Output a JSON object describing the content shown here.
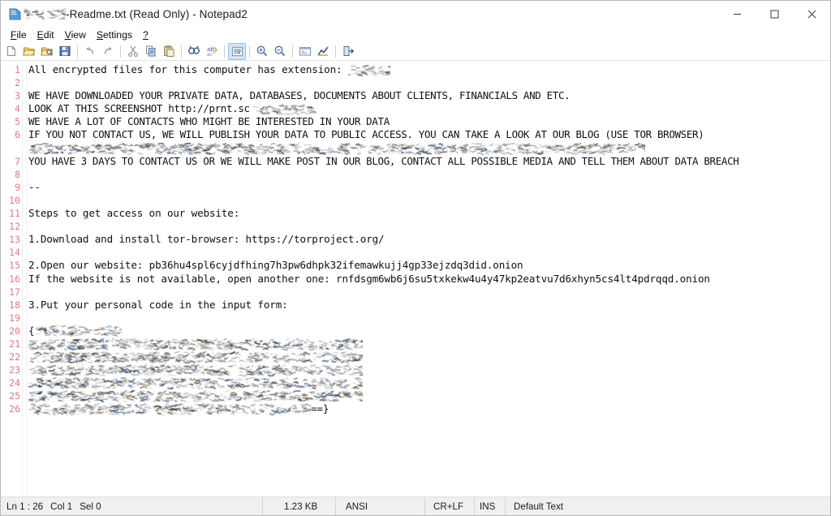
{
  "window": {
    "title_prefix_redacted": true,
    "title": "-Readme.txt (Read Only) - Notepad2",
    "icon": "notepad2-icon",
    "controls": {
      "minimize": "minimize-icon",
      "maximize": "maximize-icon",
      "close": "close-icon"
    }
  },
  "menubar": {
    "items": [
      {
        "label": "File",
        "mnemonic": "F"
      },
      {
        "label": "Edit",
        "mnemonic": "E"
      },
      {
        "label": "View",
        "mnemonic": "V"
      },
      {
        "label": "Settings",
        "mnemonic": "S"
      },
      {
        "label": "?",
        "mnemonic": "?"
      }
    ]
  },
  "toolbar": {
    "buttons": [
      {
        "name": "new-file-icon",
        "title": "New"
      },
      {
        "name": "open-file-icon",
        "title": "Open"
      },
      {
        "name": "browse-file-icon",
        "title": "Browse"
      },
      {
        "name": "save-file-icon",
        "title": "Save"
      },
      {
        "name": "undo-icon",
        "title": "Undo"
      },
      {
        "name": "redo-icon",
        "title": "Redo"
      },
      {
        "name": "cut-icon",
        "title": "Cut"
      },
      {
        "name": "copy-icon",
        "title": "Copy"
      },
      {
        "name": "paste-icon",
        "title": "Paste"
      },
      {
        "name": "find-icon",
        "title": "Find"
      },
      {
        "name": "replace-icon",
        "title": "Replace"
      },
      {
        "name": "word-wrap-icon",
        "title": "Word Wrap",
        "active": true
      },
      {
        "name": "zoom-in-icon",
        "title": "Zoom In"
      },
      {
        "name": "zoom-out-icon",
        "title": "Zoom Out"
      },
      {
        "name": "scheme-icon",
        "title": "Scheme"
      },
      {
        "name": "favorites-icon",
        "title": "Favorites"
      },
      {
        "name": "exit-icon",
        "title": "Exit"
      }
    ]
  },
  "editor": {
    "line_numbers": [
      "1",
      "2",
      "3",
      "4",
      "5",
      "6",
      "",
      "7",
      "8",
      "9",
      "10",
      "11",
      "12",
      "13",
      "14",
      "15",
      "16",
      "17",
      "18",
      "19",
      "20",
      "21",
      "22",
      "23",
      "24",
      "25",
      "26"
    ],
    "lines": [
      {
        "n": "1",
        "text": "All encrypted files for this computer has extension: ",
        "redact_after": 1
      },
      {
        "n": "2",
        "text": ""
      },
      {
        "n": "3",
        "text": "WE HAVE DOWNLOADED YOUR PRIVATE DATA, DATABASES, DOCUMENTS ABOUT CLIENTS, FINANCIALS AND ETC.",
        "caps": true
      },
      {
        "n": "4",
        "text": "LOOK AT THIS SCREENSHOT http://prnt.sc",
        "redact_after": 2,
        "caps": true
      },
      {
        "n": "5",
        "text": "WE HAVE A LOT OF CONTACTS WHO MIGHT BE INTERESTED IN YOUR DATA",
        "caps": true
      },
      {
        "n": "6",
        "text": "IF YOU NOT CONTACT US, WE WILL PUBLISH YOUR DATA TO PUBLIC ACCESS. YOU CAN TAKE A LOOK AT OUR BLOG (USE TOR BROWSER)",
        "caps": true
      },
      {
        "n": "",
        "text": "",
        "redact_full": 3
      },
      {
        "n": "7",
        "text": "YOU HAVE 3 DAYS TO CONTACT US OR WE WILL MAKE POST IN OUR BLOG, CONTACT ALL POSSIBLE MEDIA AND TELL THEM ABOUT DATA BREACH",
        "caps": true
      },
      {
        "n": "8",
        "text": ""
      },
      {
        "n": "9",
        "text": "--"
      },
      {
        "n": "10",
        "text": ""
      },
      {
        "n": "11",
        "text": "Steps to get access on our website:"
      },
      {
        "n": "12",
        "text": ""
      },
      {
        "n": "13",
        "text": "1.Download and install tor-browser: https://torproject.org/"
      },
      {
        "n": "14",
        "text": ""
      },
      {
        "n": "15",
        "text": "2.Open our website: pb36hu4spl6cyjdfhing7h3pw6dhpk32ifemawkujj4gp33ejzdq3did.onion"
      },
      {
        "n": "16",
        "text": "If the website is not available, open another one: rnfdsgm6wb6j6su5txkekw4u4y47kp2eatvu7d6xhyn5cs4lt4pdrqqd.onion"
      },
      {
        "n": "17",
        "text": ""
      },
      {
        "n": "18",
        "text": "3.Put your personal code in the input form:"
      },
      {
        "n": "19",
        "text": ""
      },
      {
        "n": "20",
        "text": "{",
        "redact_after": 4
      },
      {
        "n": "21",
        "text": "",
        "redact_full": 5
      },
      {
        "n": "22",
        "text": "",
        "redact_full": 6
      },
      {
        "n": "23",
        "text": "",
        "redact_full": 7
      },
      {
        "n": "24",
        "text": "",
        "redact_full": 8
      },
      {
        "n": "25",
        "text": "",
        "redact_full": 9
      },
      {
        "n": "26",
        "text": "",
        "redact_full": 10,
        "suffix": "==}"
      }
    ]
  },
  "statusbar": {
    "line_label": "Ln 1 : 26",
    "col_label": "Col 1",
    "sel_label": "Sel 0",
    "file_size": "1.23 KB",
    "encoding": "ANSI",
    "line_endings": "CR+LF",
    "insert_mode": "INS",
    "scheme": "Default Text"
  },
  "colors": {
    "line_number": "#e0787f",
    "text": "#111111",
    "toolbar_active_bg": "#d2e6f7",
    "statusbar_bg": "#f0f0f0",
    "window_bg": "#ffffff"
  }
}
